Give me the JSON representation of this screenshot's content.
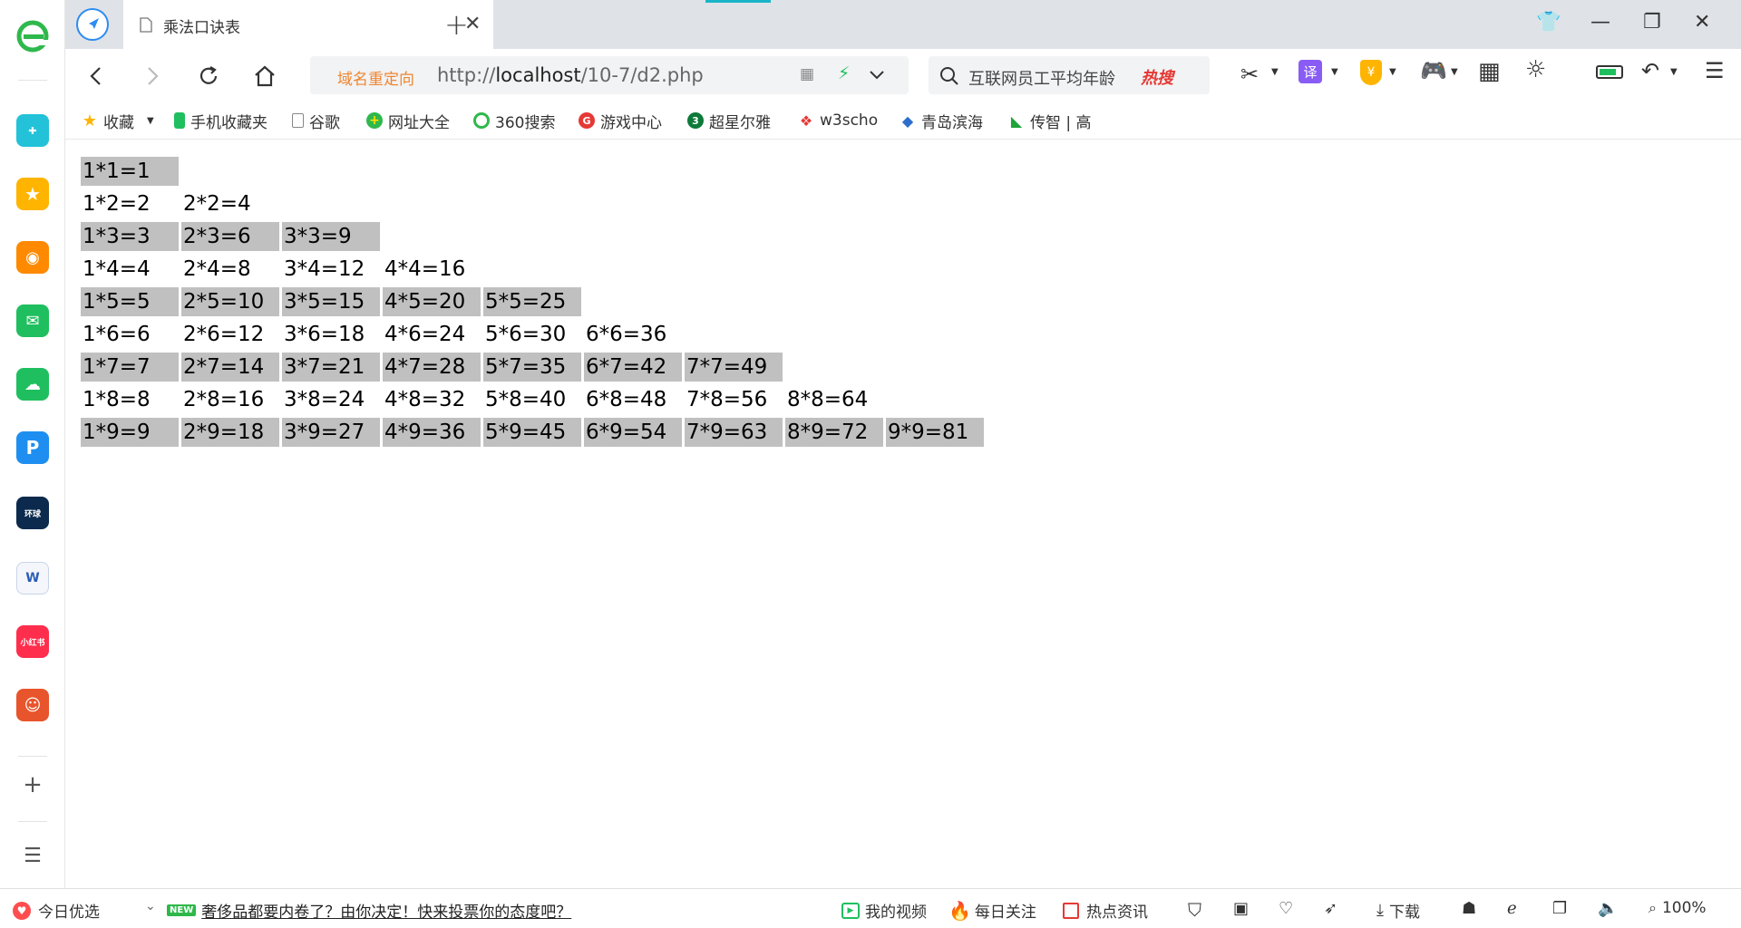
{
  "tab": {
    "title": "乘法口诀表"
  },
  "address_bar": {
    "redirect_label": "域名重定向",
    "url_prefix": "http://",
    "url_host": "localhost",
    "url_path": "/10-7/d2.php"
  },
  "search_box": {
    "text": "互联网员工平均年龄",
    "hot_label": "热搜"
  },
  "bookmarks": [
    {
      "label": "收藏",
      "icon": "star-icon"
    },
    {
      "label": "手机收藏夹",
      "icon": "phone-icon"
    },
    {
      "label": "谷歌",
      "icon": "page-icon"
    },
    {
      "label": "网址大全",
      "icon": "plus-circle-icon"
    },
    {
      "label": "360搜索",
      "icon": "search-360-icon"
    },
    {
      "label": "游戏中心",
      "icon": "game-center-icon"
    },
    {
      "label": "超星尔雅",
      "icon": "chaoxing-icon"
    },
    {
      "label": "w3scho",
      "icon": "w3school-icon"
    },
    {
      "label": "青岛滨海",
      "icon": "qingdao-icon"
    },
    {
      "label": "传智 | 高",
      "icon": "chuanzhi-icon"
    }
  ],
  "table": {
    "rows": [
      [
        "1*1=1"
      ],
      [
        "1*2=2",
        "2*2=4"
      ],
      [
        "1*3=3",
        "2*3=6",
        "3*3=9"
      ],
      [
        "1*4=4",
        "2*4=8",
        "3*4=12",
        "4*4=16"
      ],
      [
        "1*5=5",
        "2*5=10",
        "3*5=15",
        "4*5=20",
        "5*5=25"
      ],
      [
        "1*6=6",
        "2*6=12",
        "3*6=18",
        "4*6=24",
        "5*6=30",
        "6*6=36"
      ],
      [
        "1*7=7",
        "2*7=14",
        "3*7=21",
        "4*7=28",
        "5*7=35",
        "6*7=42",
        "7*7=49"
      ],
      [
        "1*8=8",
        "2*8=16",
        "3*8=24",
        "4*8=32",
        "5*8=40",
        "6*8=48",
        "7*8=56",
        "8*8=64"
      ],
      [
        "1*9=9",
        "2*9=18",
        "3*9=27",
        "4*9=36",
        "5*9=45",
        "6*9=54",
        "7*9=63",
        "8*9=72",
        "9*9=81"
      ]
    ],
    "shaded_color": "#c0c0c0"
  },
  "status_bar": {
    "today_pick": "今日优选",
    "new_badge": "NEW",
    "news_link": "奢侈品都要内卷了？由你决定！快来投票你的态度吧？",
    "my_video": "我的视频",
    "daily_follow": "每日关注",
    "hot_news": "热点资讯",
    "download": "下载",
    "zoom": "100%"
  },
  "colors": {
    "accent_blue": "#2d8cf0",
    "redirect_orange": "#f0852f",
    "hot_red": "#e53935",
    "tab_bar_bg": "#dfe3e8"
  }
}
